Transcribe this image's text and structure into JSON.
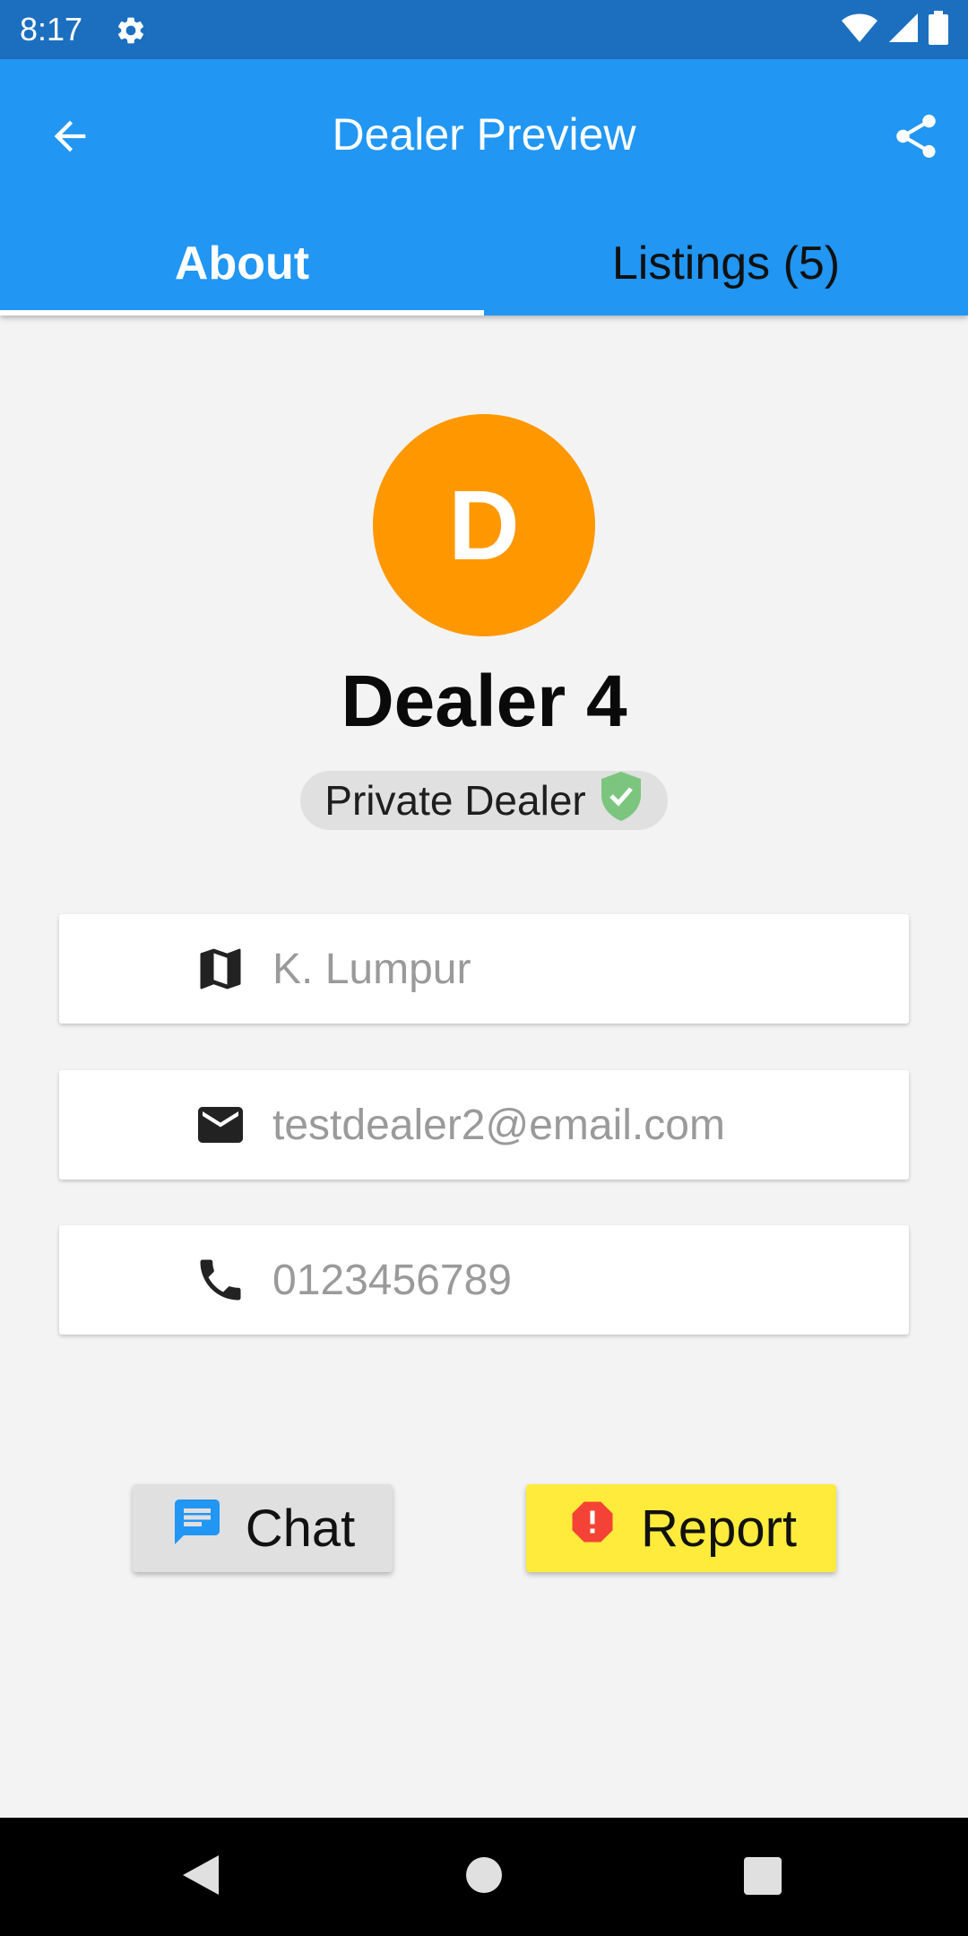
{
  "status_bar": {
    "time": "8:17",
    "icons": [
      "settings-icon",
      "wifi-icon",
      "signal-icon",
      "battery-icon"
    ]
  },
  "app_bar": {
    "title": "Dealer Preview",
    "back_icon": "arrow-left-icon",
    "share_icon": "share-icon",
    "color": "#2196f3"
  },
  "tabs": [
    {
      "label": "About",
      "selected": true
    },
    {
      "label": "Listings (5)",
      "selected": false
    }
  ],
  "profile": {
    "avatar_letter": "D",
    "avatar_color": "#ff9800",
    "name": "Dealer 4",
    "badge_label": "Private Dealer",
    "badge_icon": "verified-shield-icon"
  },
  "contact": [
    {
      "icon": "map-icon",
      "value": "K. Lumpur"
    },
    {
      "icon": "email-icon",
      "value": "testdealer2@email.com"
    },
    {
      "icon": "phone-icon",
      "value": "0123456789"
    }
  ],
  "actions": {
    "chat_label": "Chat",
    "chat_icon": "chat-icon",
    "report_label": "Report",
    "report_icon": "report-icon",
    "report_color": "#ffeb3b"
  },
  "nav_bar": {
    "icons": [
      "nav-back-icon",
      "nav-home-icon",
      "nav-recents-icon"
    ]
  }
}
